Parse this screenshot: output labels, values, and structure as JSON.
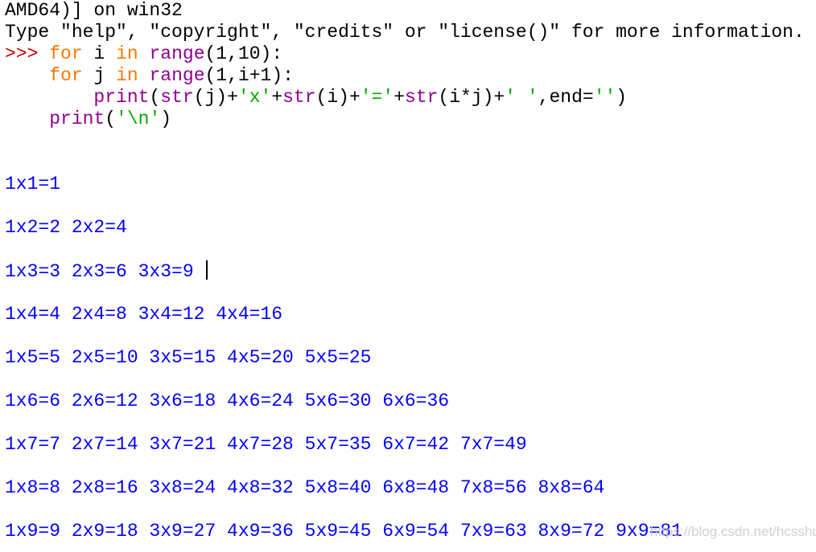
{
  "colors": {
    "default": "#000000",
    "prompt": "#c00000",
    "keyword": "#ff7700",
    "builtin": "#900090",
    "string": "#00aa00",
    "output": "#0000ff"
  },
  "shell": {
    "lines": [
      [
        {
          "t": "AMD64)] on win32",
          "c": "default"
        }
      ],
      [
        {
          "t": "Type \"help\", \"copyright\", \"credits\" or \"license()\" for more information.",
          "c": "default"
        }
      ],
      [
        {
          "t": ">>> ",
          "c": "prompt"
        },
        {
          "t": "for",
          "c": "keyword"
        },
        {
          "t": " i ",
          "c": "default"
        },
        {
          "t": "in",
          "c": "keyword"
        },
        {
          "t": " ",
          "c": "default"
        },
        {
          "t": "range",
          "c": "builtin"
        },
        {
          "t": "(1,10):",
          "c": "default"
        }
      ],
      [
        {
          "t": "    ",
          "c": "default"
        },
        {
          "t": "for",
          "c": "keyword"
        },
        {
          "t": " j ",
          "c": "default"
        },
        {
          "t": "in",
          "c": "keyword"
        },
        {
          "t": " ",
          "c": "default"
        },
        {
          "t": "range",
          "c": "builtin"
        },
        {
          "t": "(1,i+1):",
          "c": "default"
        }
      ],
      [
        {
          "t": "        ",
          "c": "default"
        },
        {
          "t": "print",
          "c": "builtin"
        },
        {
          "t": "(",
          "c": "default"
        },
        {
          "t": "str",
          "c": "builtin"
        },
        {
          "t": "(j)+",
          "c": "default"
        },
        {
          "t": "'x'",
          "c": "string"
        },
        {
          "t": "+",
          "c": "default"
        },
        {
          "t": "str",
          "c": "builtin"
        },
        {
          "t": "(i)+",
          "c": "default"
        },
        {
          "t": "'='",
          "c": "string"
        },
        {
          "t": "+",
          "c": "default"
        },
        {
          "t": "str",
          "c": "builtin"
        },
        {
          "t": "(i*j)+",
          "c": "default"
        },
        {
          "t": "' '",
          "c": "string"
        },
        {
          "t": ",end=",
          "c": "default"
        },
        {
          "t": "''",
          "c": "string"
        },
        {
          "t": ")",
          "c": "default"
        }
      ],
      [
        {
          "t": "    ",
          "c": "default"
        },
        {
          "t": "print",
          "c": "builtin"
        },
        {
          "t": "(",
          "c": "default"
        },
        {
          "t": "'\\n'",
          "c": "string"
        },
        {
          "t": ")",
          "c": "default"
        }
      ],
      [],
      [],
      [
        {
          "t": "1x1=1",
          "c": "output"
        }
      ],
      [],
      [
        {
          "t": "1x2=2 2x2=4",
          "c": "output"
        }
      ],
      [],
      [
        {
          "t": "1x3=3 2x3=6 3x3=9 ",
          "c": "output",
          "cursor": true
        }
      ],
      [],
      [
        {
          "t": "1x4=4 2x4=8 3x4=12 4x4=16",
          "c": "output"
        }
      ],
      [],
      [
        {
          "t": "1x5=5 2x5=10 3x5=15 4x5=20 5x5=25",
          "c": "output"
        }
      ],
      [],
      [
        {
          "t": "1x6=6 2x6=12 3x6=18 4x6=24 5x6=30 6x6=36",
          "c": "output"
        }
      ],
      [],
      [
        {
          "t": "1x7=7 2x7=14 3x7=21 4x7=28 5x7=35 6x7=42 7x7=49",
          "c": "output"
        }
      ],
      [],
      [
        {
          "t": "1x8=8 2x8=16 3x8=24 4x8=32 5x8=40 6x8=48 7x8=56 8x8=64",
          "c": "output"
        }
      ],
      [],
      [
        {
          "t": "1x9=9 2x9=18 3x9=27 4x9=36 5x9=45 6x9=54 7x9=63 8x9=72 9x9=81",
          "c": "output"
        }
      ]
    ]
  },
  "watermark": "https://blog.csdn.net/hcsshui"
}
